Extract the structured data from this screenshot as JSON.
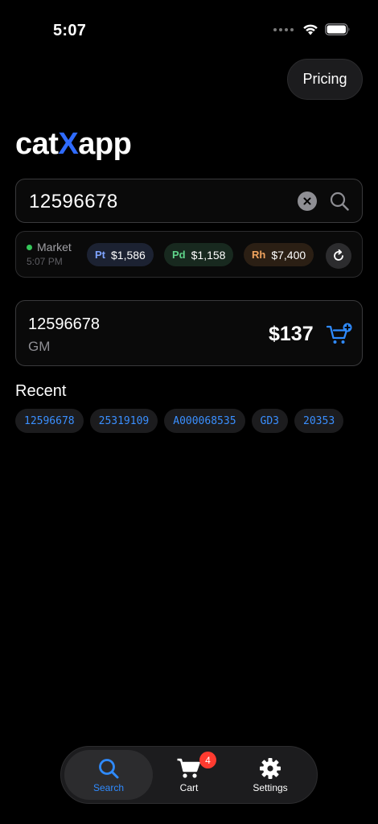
{
  "status_bar": {
    "time": "5:07"
  },
  "header": {
    "pricing_label": "Pricing"
  },
  "logo": {
    "prefix": "cat",
    "highlight": "X",
    "suffix": "app",
    "accent_color": "#2f6bff"
  },
  "search": {
    "value": "12596678",
    "clear_icon": "clear-icon",
    "search_icon": "search-icon"
  },
  "market": {
    "label": "Market",
    "time": "5:07 PM",
    "status_color": "#34c759",
    "metals": [
      {
        "symbol": "Pt",
        "price": "$1,586"
      },
      {
        "symbol": "Pd",
        "price": "$1,158"
      },
      {
        "symbol": "Rh",
        "price": "$7,400"
      }
    ],
    "refresh_icon": "refresh-icon"
  },
  "result": {
    "part_number": "12596678",
    "make": "GM",
    "price": "$137",
    "add_to_cart_icon": "add-to-cart-icon"
  },
  "recent": {
    "title": "Recent",
    "items": [
      "12596678",
      "25319109",
      "A000068535",
      "GD3",
      "20353"
    ]
  },
  "tab_bar": {
    "tabs": [
      {
        "label": "Search",
        "icon": "search-icon",
        "active": true
      },
      {
        "label": "Cart",
        "icon": "cart-icon",
        "badge": "4"
      },
      {
        "label": "Settings",
        "icon": "gear-icon"
      }
    ],
    "active_color": "#2f8bff",
    "badge_color": "#ff3b30"
  }
}
